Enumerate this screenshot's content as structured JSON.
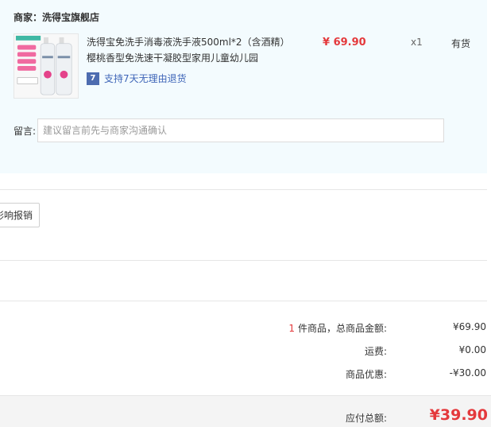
{
  "shop": {
    "title": "商家：洗得宝旗舰店"
  },
  "product": {
    "name": "洗得宝免洗手消毒液洗手液500ml*2（含酒精）樱桃香型免洗速干凝胶型家用儿童幼儿园",
    "return_badge_icon": "7",
    "return_text": "支持7天无理由退货",
    "price": "¥ 69.90",
    "qty": "x1",
    "stock": "有货"
  },
  "remark": {
    "label": "留言:",
    "placeholder": "建议留言前先与商家沟通确认"
  },
  "report_button": "影响报销",
  "summary": {
    "count": "1",
    "goods_label": "件商品，总商品金额:",
    "goods_value": "¥69.90",
    "shipping_label": "运费:",
    "shipping_value": "¥0.00",
    "discount_label": "商品优惠:",
    "discount_value": "-¥30.00",
    "total_label": "应付总额:",
    "total_value": "¥39.90"
  },
  "colors": {
    "accent_red": "#e4393c",
    "link_blue": "#3f66b8",
    "panel_bg": "#f3fbfe"
  },
  "icons": {
    "product_thumb": "product-bottle-image",
    "return_badge": "seven-day-return-icon"
  }
}
